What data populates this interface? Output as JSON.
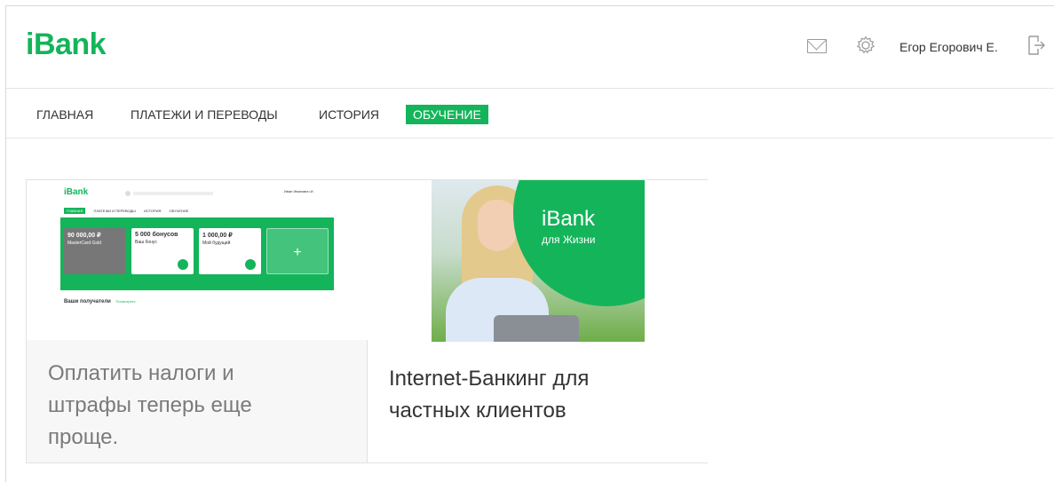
{
  "header": {
    "logo": "iBank",
    "user_name": "Егор Егорович Е.",
    "icons": [
      "mail-icon",
      "gear-icon",
      "logout-icon"
    ]
  },
  "nav": {
    "items": [
      {
        "label": "ГЛАВНАЯ",
        "active": false
      },
      {
        "label": "ПЛАТЕЖИ И ПЕРЕВОДЫ",
        "active": false
      },
      {
        "label": "ИСТОРИЯ",
        "active": false
      },
      {
        "label": "ОБУЧЕНИЕ",
        "active": true
      }
    ]
  },
  "cards": [
    {
      "text": "Оплатить налоги и штрафы теперь еще проще.",
      "thumbnail": {
        "logo": "iBank",
        "user": "Иван Иванович И.",
        "nav": [
          "ГЛАВНАЯ",
          "ПЛАТЕЖИ И ПЕРЕВОДЫ",
          "ИСТОРИЯ",
          "ОБУЧЕНИЕ"
        ],
        "mini_cards": [
          {
            "amount": "90 000,00 ₽",
            "label": "MasterCard Gold"
          },
          {
            "amount": "5 000 бонусов",
            "label": "Ваш бонус"
          },
          {
            "amount": "1 000,00 ₽",
            "label": "Мой будущий"
          }
        ],
        "recipients": "Ваши получатели",
        "recipients_link": "Посмотреть"
      }
    },
    {
      "text": "Internet-Банкинг для частных клиентов",
      "promo": {
        "title": "iBank",
        "subtitle": "для Жизни"
      }
    }
  ],
  "colors": {
    "accent": "#14b45a"
  }
}
